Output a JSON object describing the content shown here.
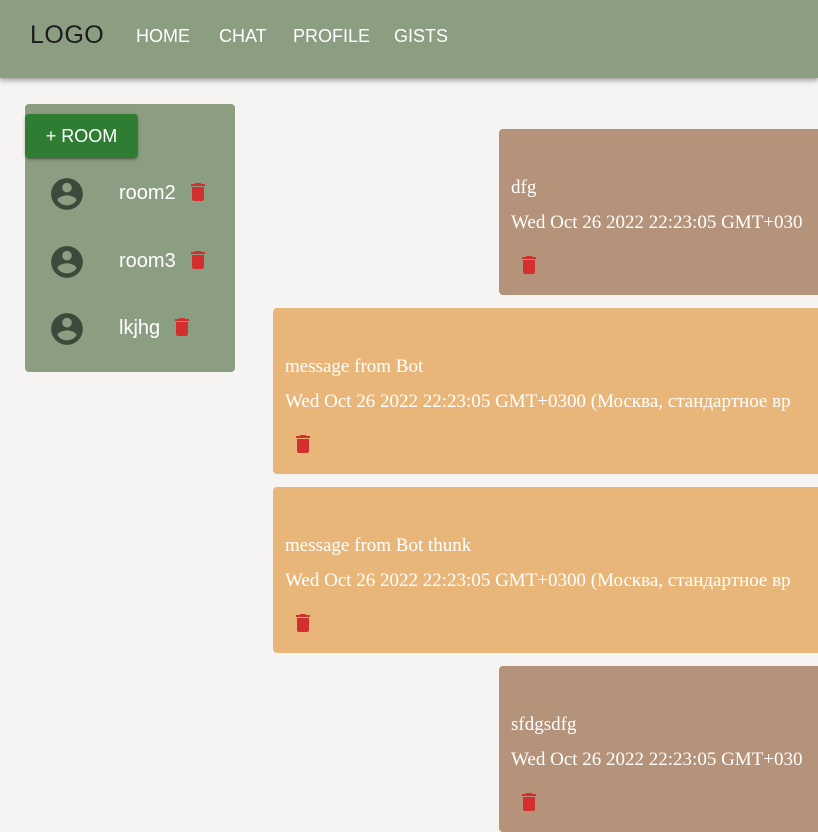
{
  "header": {
    "logo": "LOGO",
    "nav": [
      {
        "label": "HOME"
      },
      {
        "label": "CHAT"
      },
      {
        "label": "PROFILE"
      },
      {
        "label": "GISTS"
      }
    ]
  },
  "sidebar": {
    "add_room_label": "+ ROOM",
    "rooms": [
      {
        "name": "room2",
        "icon": "account-circle-icon"
      },
      {
        "name": "room3",
        "icon": "account-circle-icon"
      },
      {
        "name": "lkjhg",
        "icon": "account-circle-icon"
      }
    ]
  },
  "messages": [
    {
      "text": "dfg",
      "date": "Wed Oct 26 2022 22:23:05 GMT+030",
      "author": "user"
    },
    {
      "text": "message from Bot",
      "date": "Wed Oct 26 2022 22:23:05 GMT+0300 (Москва, стандартное вр",
      "author": "bot"
    },
    {
      "text": "message from Bot thunk",
      "date": "Wed Oct 26 2022 22:23:05 GMT+0300 (Москва, стандартное вр",
      "author": "bot"
    },
    {
      "text": "sfdgsdfg",
      "date": "Wed Oct 26 2022 22:23:05 GMT+030",
      "author": "user"
    }
  ],
  "colors": {
    "appbar": "#8c9e82",
    "add_room_button": "#2e7d32",
    "user_message": "#b4937a",
    "bot_message": "#e9b679",
    "delete_icon": "#d32f2f",
    "avatar": "#3b4a3a"
  }
}
